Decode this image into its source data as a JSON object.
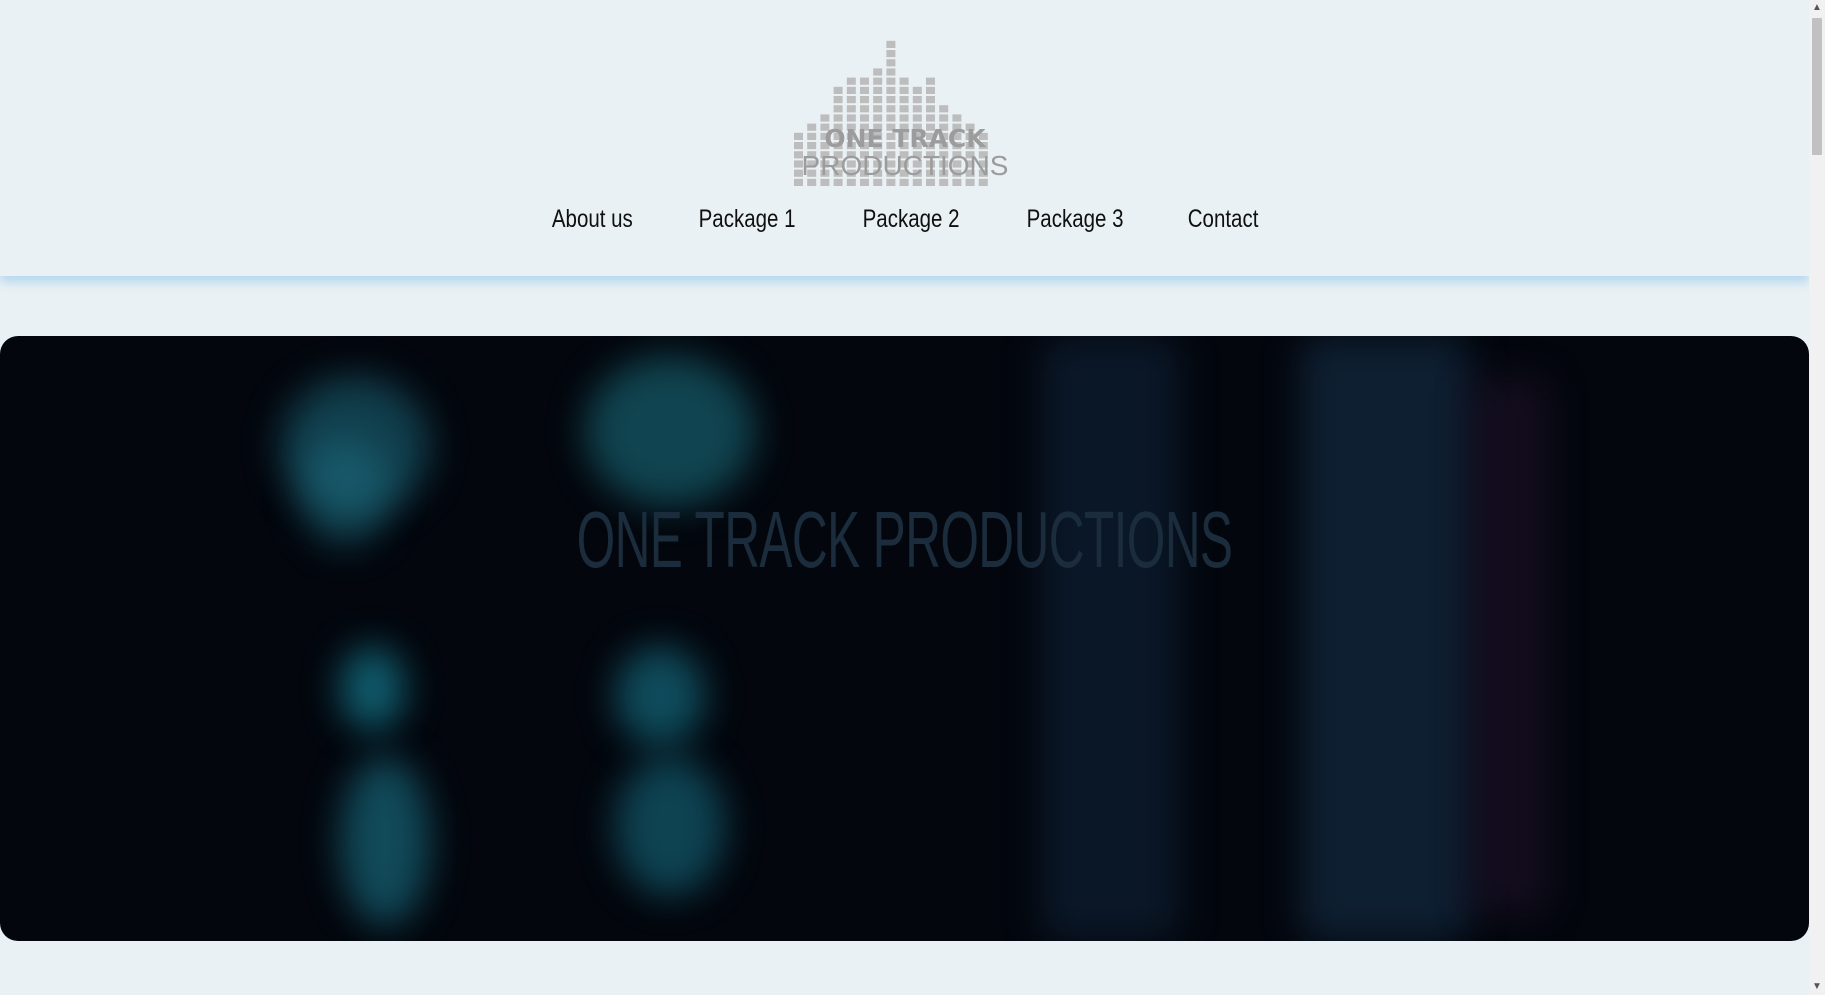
{
  "header": {
    "logo": {
      "line1": "ONE TRACK",
      "line2": "PRODUCTIONS"
    },
    "nav": [
      {
        "label": "About us"
      },
      {
        "label": "Package 1"
      },
      {
        "label": "Package 2"
      },
      {
        "label": "Package 3"
      },
      {
        "label": "Contact"
      }
    ]
  },
  "hero": {
    "title": "ONE TRACK PRODUCTIONS"
  },
  "colors": {
    "background": "#eaf1f5",
    "header_shadow": "#96c8eb",
    "hero_bg": "#03060d",
    "hero_title": "#1b2c3c",
    "logo_gray": "#9c9c9c"
  },
  "icons": {
    "scroll_up": "chevron-up-icon",
    "scroll_down": "chevron-down-icon"
  }
}
